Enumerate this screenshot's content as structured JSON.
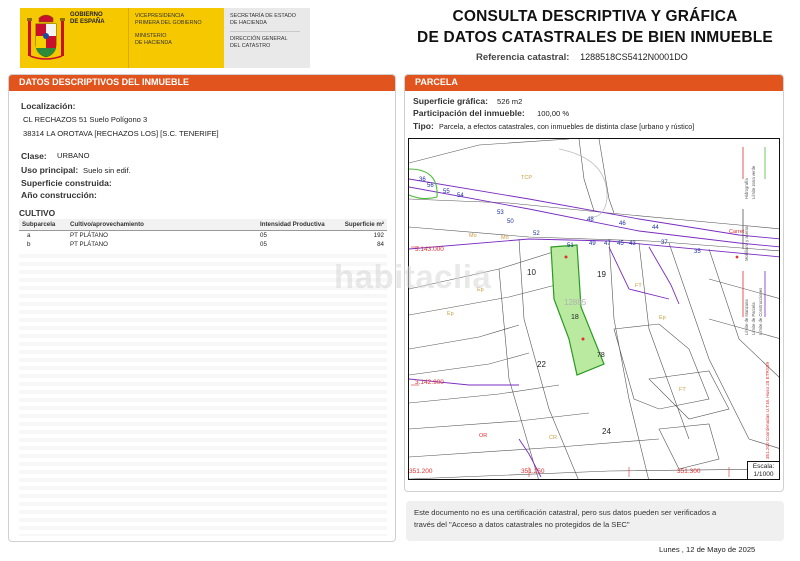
{
  "header": {
    "gov_block1": [
      "GOBIERNO",
      "DE ESPAÑA"
    ],
    "gov_block2a": [
      "VICEPRESIDENCIA",
      "PRIMERA DEL GOBIERNO"
    ],
    "gov_block2b": [
      "MINISTERIO",
      "DE HACIENDA"
    ],
    "gov_block3a": [
      "SECRETARÍA DE ESTADO",
      "DE HACIENDA"
    ],
    "gov_block3b": [
      "DIRECCIÓN GENERAL",
      "DEL CATASTRO"
    ],
    "title_line1": "CONSULTA DESCRIPTIVA Y GRÁFICA",
    "title_line2": "DE DATOS CATASTRALES DE BIEN INMUEBLE",
    "ref_label": "Referencia catastral:",
    "ref_value": "1288518CS5412N0001DO",
    "crest_icon": "coat-of-arms-icon",
    "colors": {
      "gov_yellow": "#f6c800",
      "gov_grey": "#e9e9e9",
      "section_bar": "#e2541e"
    }
  },
  "left": {
    "section_title": "DATOS DESCRIPTIVOS DEL INMUEBLE",
    "localizacion_label": "Localización:",
    "localizacion_line1": "CL RECHAZOS 51 Suelo Polígono 3",
    "localizacion_line2": "38314 LA OROTAVA [RECHAZOS LOS] [S.C. TENERIFE]",
    "clase_label": "Clase:",
    "clase_value": "URBANO",
    "uso_label": "Uso principal:",
    "uso_value": "Suelo sin edif.",
    "superficie_label": "Superficie construida:",
    "anio_label": "Año construcción:",
    "cultivo": {
      "title": "CULTIVO",
      "headers": [
        "Subparcela",
        "Cultivo/aprovechamiento",
        "Intensidad Productiva",
        "Superficie m²"
      ],
      "rows": [
        [
          "a",
          "PT PLÁTANO",
          "05",
          "192"
        ],
        [
          "b",
          "PT PLÁTANO",
          "05",
          "84"
        ]
      ]
    }
  },
  "right": {
    "section_title": "PARCELA",
    "superficie_label": "Superficie gráfica:",
    "superficie_value": "526 m2",
    "participacion_label": "Participación del inmueble:",
    "participacion_value": "100,00 %",
    "tipo_label": "Tipo:",
    "tipo_value": "Parcela, a efectos catastrales, con inmuebles de distinta clase [urbano y rústico]",
    "map": {
      "parcel_labels": [
        "10",
        "19",
        "18",
        "22",
        "78",
        "24",
        "12885"
      ],
      "street_numbers": [
        "56",
        "55",
        "54",
        "53",
        "52",
        "50",
        "51",
        "49",
        "47",
        "45",
        "43",
        "44",
        "46",
        "48",
        "37",
        "35",
        "36"
      ],
      "coord_labels": [
        "3.143.000",
        "3.142.900",
        "351.200",
        "351.250",
        "351.300"
      ],
      "misc_labels": [
        "Carret",
        "Mo",
        "Mo",
        "Ep",
        "Ep",
        "TCP",
        "FT",
        "OR",
        "CR",
        "FT",
        "Ep"
      ],
      "legend_lines": [
        "Límite de Manzana",
        "Límite de Parcela",
        "Límite de Construcciones",
        "Mobiliario y aceras",
        "Límite zona verde",
        "Hidrografía"
      ],
      "side_text": "351.200 Coordenadas U.T.M. Huso 28 ETRS89",
      "escala_label": "Escala:",
      "escala_value": "1/1000",
      "colors": {
        "parcel_fill": "#b9eaa0",
        "parcel_stroke": "#2a9a20",
        "lot_lines": "#7a2cc0",
        "coord_red": "#e03030",
        "green_zone": "#4dbb3a"
      }
    }
  },
  "note": {
    "line1": "Este documento no es una certificación catastral, pero sus datos pueden ser verificados a",
    "line2": "través del \"Acceso a datos catastrales no protegidos de la SEC\""
  },
  "date": "Lunes , 12 de Mayo de 2025",
  "watermark": "habitaclia"
}
